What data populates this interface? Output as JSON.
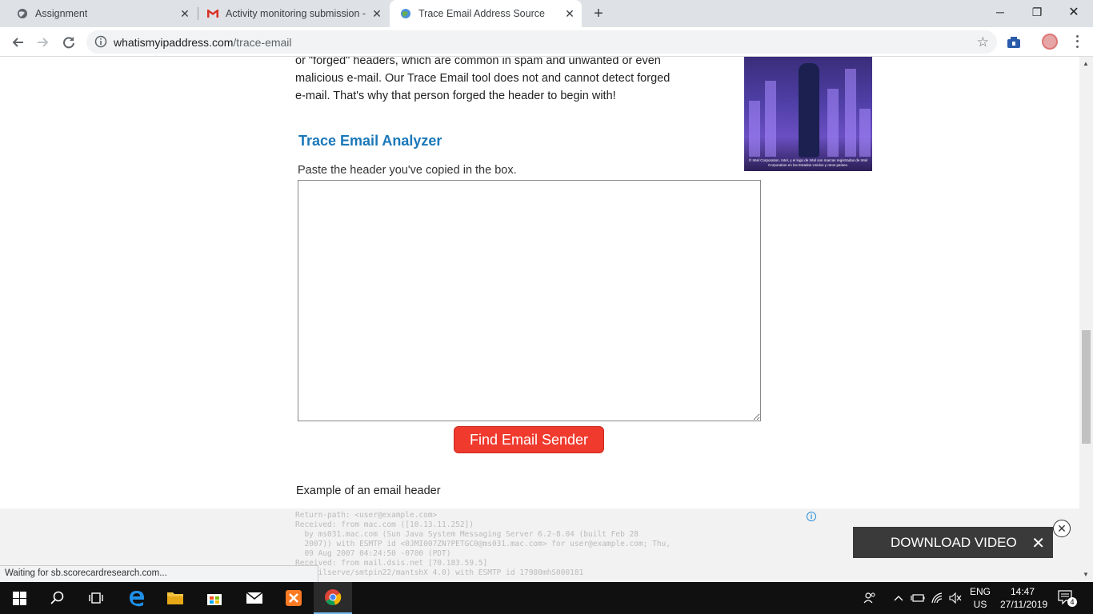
{
  "browser": {
    "tabs": [
      {
        "label": "Assignment",
        "icon": "globe-icon"
      },
      {
        "label": "Activity monitoring submission -",
        "icon": "gmail-icon"
      },
      {
        "label": "Trace Email Address Source",
        "icon": "globe-icon",
        "active": true
      }
    ],
    "url_host": "whatismyipaddress.com",
    "url_path": "/trace-email"
  },
  "page": {
    "intro_text": "or \"forged\" headers, which are common in spam and unwanted or even malicious e-mail. Our Trace Email tool does not and cannot detect forged e-mail. That's why that person forged the header to begin with!",
    "ad_caption": "© Intel Corporation. Intel, y el logo de Intel son marcas registradas de Intel Corporation en los Estados Unidos y otros países.",
    "analyzer_title": "Trace Email Analyzer",
    "paste_label": "Paste the header you've copied in the box.",
    "header_value": "",
    "find_button": "Find Email Sender",
    "example_label": "Example of an email header",
    "example_header": "Return-path: <user@example.com>\nReceived: from mac.com ([10.13.11.252])\n  by ms031.mac.com (Sun Java System Messaging Server 6.2-8.04 (built Feb 28\n  2007)) with ESMTP id <0JMI007ZN?PETGC0@ms031.mac.com> for user@example.com; Thu,\n  09 Aug 2007 04:24:50 -0700 (PDT)\nReceived: from mail.dsis.net [70.183.59.5]\n  (Mailserve/smtpin22/mantshX 4.0) with ESMTP id 17980mhS000181"
  },
  "overlay": {
    "download_video": "DOWNLOAD VIDEO",
    "status": "Waiting for sb.scorecardresearch.com..."
  },
  "taskbar": {
    "lang_line1": "ENG",
    "lang_line2": "US",
    "time": "14:47",
    "date": "27/11/2019",
    "notifications": "4"
  }
}
